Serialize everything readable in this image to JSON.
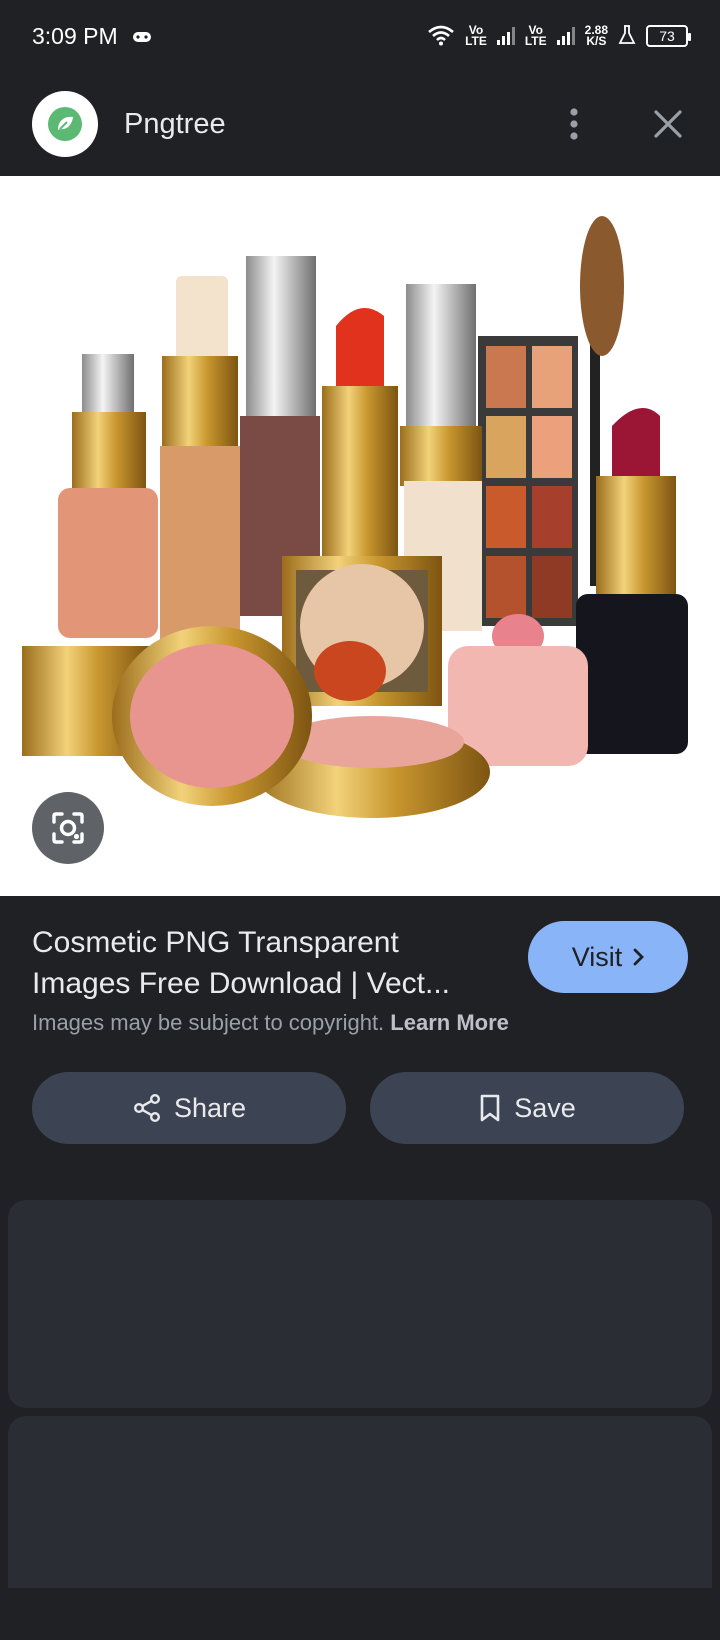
{
  "status_bar": {
    "time": "3:09 PM",
    "net1": "Vo\nLTE",
    "net2": "Vo\nLTE",
    "speed": "2.88\nK/S",
    "battery": "73"
  },
  "header": {
    "site_name": "Pngtree",
    "more_icon": "more-vert-icon",
    "close_icon": "close-icon"
  },
  "image": {
    "lens_icon": "lens-icon"
  },
  "result": {
    "title": "Cosmetic PNG Transparent Images Free Download | Vect...",
    "visit_label": "Visit",
    "copyright_text": "Images may be subject to copyright.",
    "learn_more": "Learn More",
    "share_label": "Share",
    "save_label": "Save"
  },
  "colors": {
    "background": "#202124",
    "visit_button": "#8ab4f8",
    "action_button": "#3c4454",
    "card": "#2a2d34"
  }
}
